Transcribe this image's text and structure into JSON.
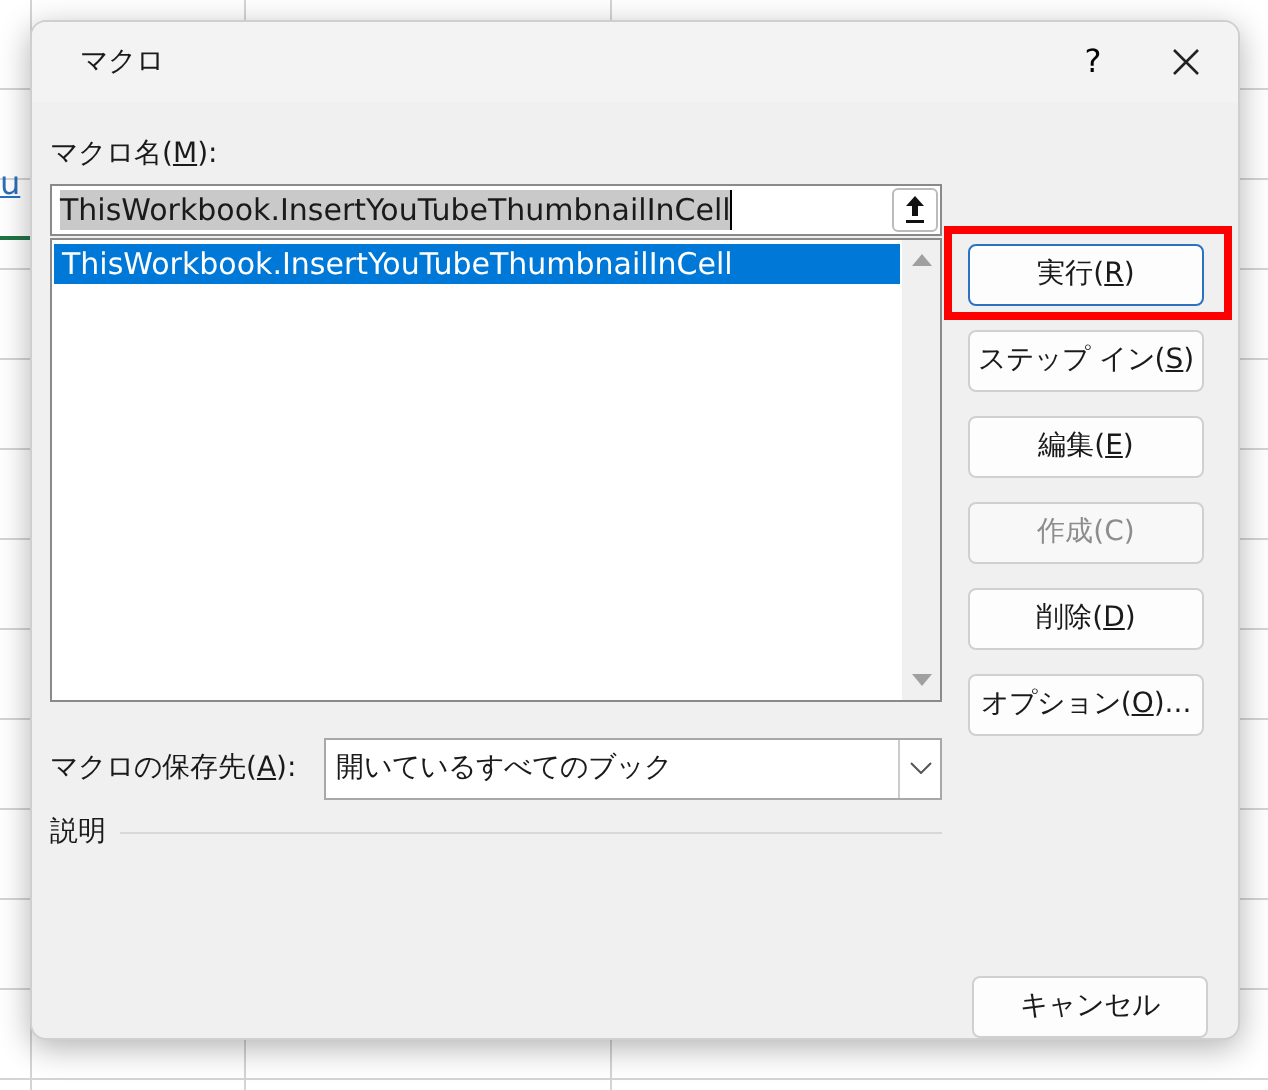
{
  "background": {
    "link_text": "u"
  },
  "dialog": {
    "title": "マクロ",
    "help": "?",
    "macro_name": {
      "label_start": "マクロ名(",
      "mnemonic": "M",
      "label_end": "):",
      "value": "ThisWorkbook.InsertYouTubeThumbnailInCell",
      "value_selected": true
    },
    "macros": [
      {
        "name": "ThisWorkbook.InsertYouTubeThumbnailInCell",
        "selected": true
      }
    ],
    "location": {
      "label_start": "マクロの保存先(",
      "mnemonic": "A",
      "label_end": "):",
      "value": "開いているすべてのブック"
    },
    "description": {
      "label": "説明"
    },
    "buttons": [
      {
        "label_start": "実行(",
        "mnemonic": "R",
        "label_end": ")",
        "default": true,
        "highlighted": true,
        "disabled": false
      },
      {
        "label_start": "ステップ イン(",
        "mnemonic": "S",
        "label_end": ")",
        "default": false,
        "highlighted": false,
        "disabled": false
      },
      {
        "label_start": "編集(",
        "mnemonic": "E",
        "label_end": ")",
        "default": false,
        "highlighted": false,
        "disabled": false
      },
      {
        "label_start": "作成(",
        "mnemonic": "C",
        "label_end": ")",
        "default": false,
        "highlighted": false,
        "disabled": true
      },
      {
        "label_start": "削除(",
        "mnemonic": "D",
        "label_end": ")",
        "default": false,
        "highlighted": false,
        "disabled": false
      },
      {
        "label_start": "オプション(",
        "mnemonic": "O",
        "label_end": ")...",
        "default": false,
        "highlighted": false,
        "disabled": false
      }
    ],
    "cancel": {
      "label": "キャンセル"
    }
  }
}
